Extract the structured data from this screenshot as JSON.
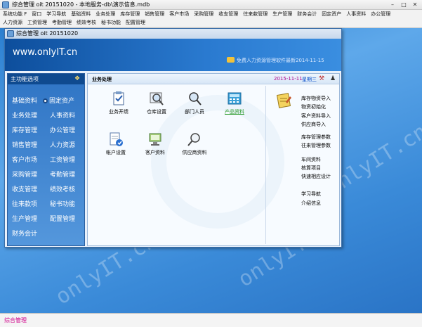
{
  "window": {
    "title": "综合管理 oit 20151020 - 本地服务-db\\演示信息.mdb"
  },
  "menubar": {
    "row1": [
      "系统功能 F",
      "窗口",
      "学习导航",
      "基础资料",
      "业务处理",
      "库存管理",
      "销售管理",
      "客户市场",
      "采购管理",
      "收支管理",
      "往来款管理",
      "生产管理",
      "财务会计",
      "固定资产",
      "人事资料",
      "办公管理"
    ],
    "row2": [
      "人力资源",
      "工资管理",
      "考勤管理",
      "绩效考核",
      "秘书功能",
      "配置管理"
    ]
  },
  "inner": {
    "title": "综合管理 oit 20151020",
    "banner_url": "www.onlyIT.cn",
    "banner_slogan": "免费人力资源管理软件最新2014-11-15"
  },
  "sidebar": {
    "header": "主功能选项",
    "items": [
      "基础资料",
      "固定资产",
      "业务处理",
      "人事资料",
      "库存管理",
      "办公管理",
      "销售管理",
      "人力资源",
      "客户市场",
      "工资管理",
      "采购管理",
      "考勤管理",
      "收支管理",
      "绩效考核",
      "往来款项",
      "秘书功能",
      "生产管理",
      "配置管理",
      "财务会计"
    ]
  },
  "panel": {
    "title": "业务处理",
    "date": "2015-11-11",
    "weekday": "星期三",
    "tiles": [
      "业务开缋",
      "仓库设置",
      "部门人员",
      "产品资料",
      "帐户设置",
      "客户资料",
      "供应商资料"
    ],
    "right_list": [
      "库存物资导入",
      "物资初始化",
      "客户资料导入",
      "供应商导入",
      "库存管理参数",
      "往来管理参数",
      "车间资料",
      "核算项目",
      "快速相应设计",
      "学习导航",
      "介绍信息"
    ]
  },
  "status": {
    "text": "综合管理"
  },
  "watermark": "onlyIT.cn",
  "colors": {
    "banner": "#0d4e9c",
    "sidebar": "#2f74c4",
    "date": "#b0008c",
    "weekday": "#0048c8",
    "link": "#2a9a2a",
    "status": "#d0008a"
  }
}
